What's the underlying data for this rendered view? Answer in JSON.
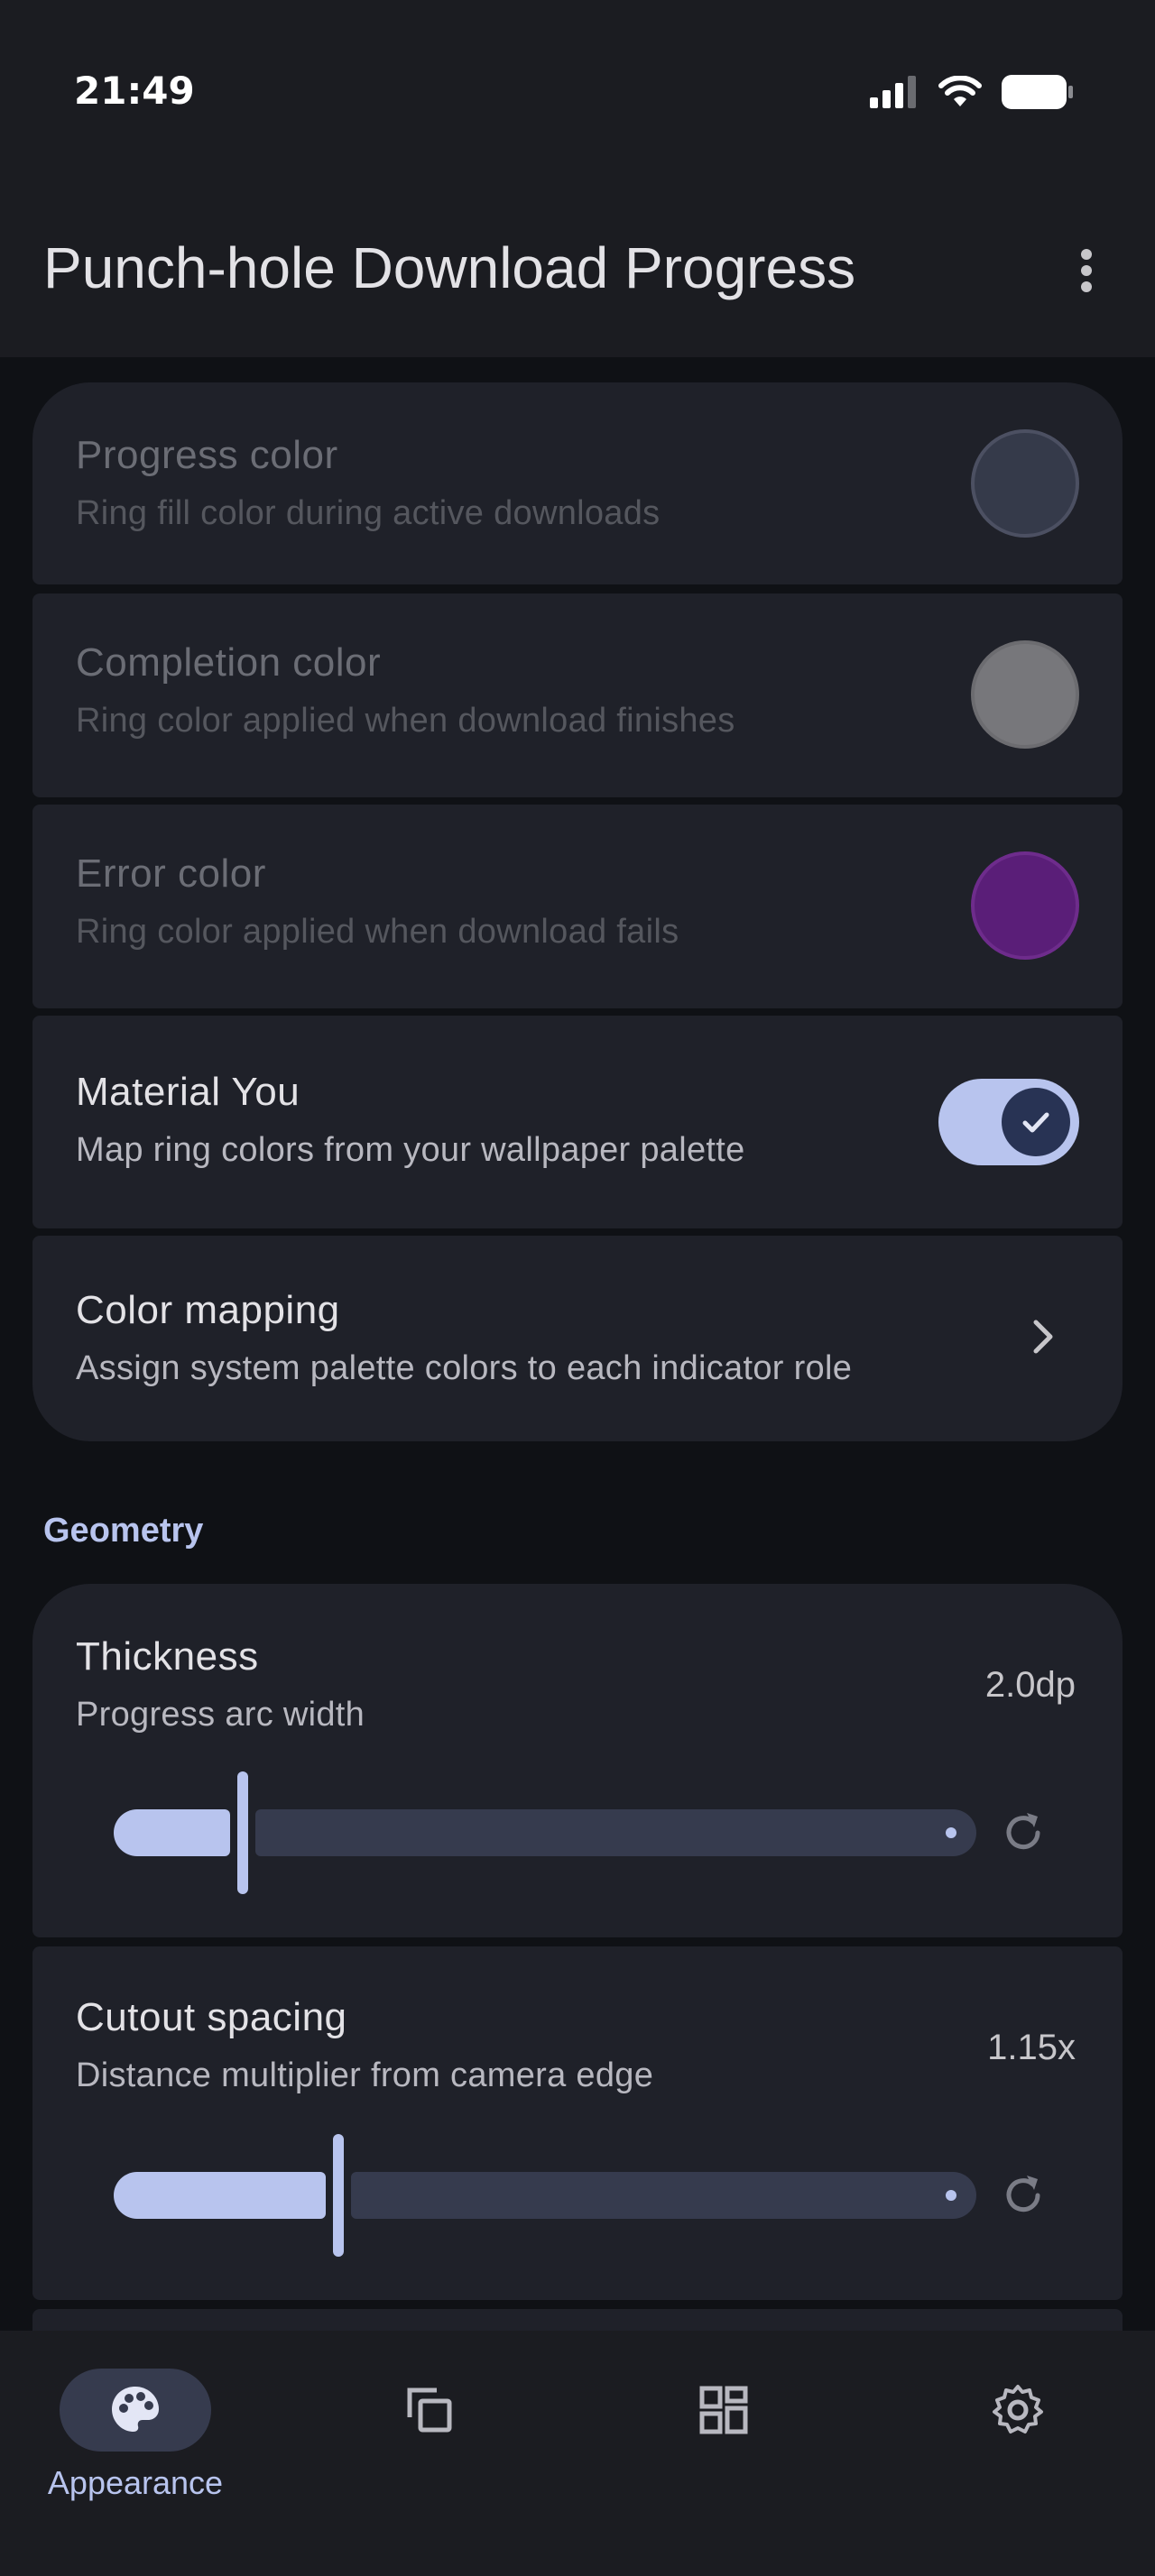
{
  "status_bar": {
    "time": "21:49"
  },
  "app_bar": {
    "title": "Punch-hole Download Progress"
  },
  "colors_section": {
    "progress_color": {
      "title": "Progress color",
      "subtitle": "Ring fill color during active downloads",
      "swatch": "#353a4a"
    },
    "completion_color": {
      "title": "Completion color",
      "subtitle": "Ring color applied when download finishes",
      "swatch": "#77777b"
    },
    "error_color": {
      "title": "Error color",
      "subtitle": "Ring color applied when download fails",
      "swatch": "#5a1e78"
    },
    "material_you": {
      "title": "Material You",
      "subtitle": "Map ring colors from your wallpaper palette",
      "enabled": true
    },
    "color_mapping": {
      "title": "Color mapping",
      "subtitle": "Assign system palette colors to each indicator role"
    }
  },
  "geometry_section": {
    "header": "Geometry",
    "thickness": {
      "title": "Thickness",
      "subtitle": "Progress arc width",
      "value_label": "2.0dp",
      "fraction": 0.15
    },
    "cutout_spacing": {
      "title": "Cutout spacing",
      "subtitle": "Distance multiplier from camera edge",
      "value_label": "1.15x",
      "fraction": 0.26
    }
  },
  "bottom_nav": {
    "items": [
      {
        "label": "Appearance",
        "icon": "palette-icon",
        "active": true
      },
      {
        "label": "",
        "icon": "copy-icon",
        "active": false
      },
      {
        "label": "",
        "icon": "dashboard-icon",
        "active": false
      },
      {
        "label": "",
        "icon": "gear-icon",
        "active": false
      }
    ]
  },
  "theme": {
    "accent": "#b8c4ee",
    "surface": "#1f2129",
    "background": "#0f1115"
  }
}
